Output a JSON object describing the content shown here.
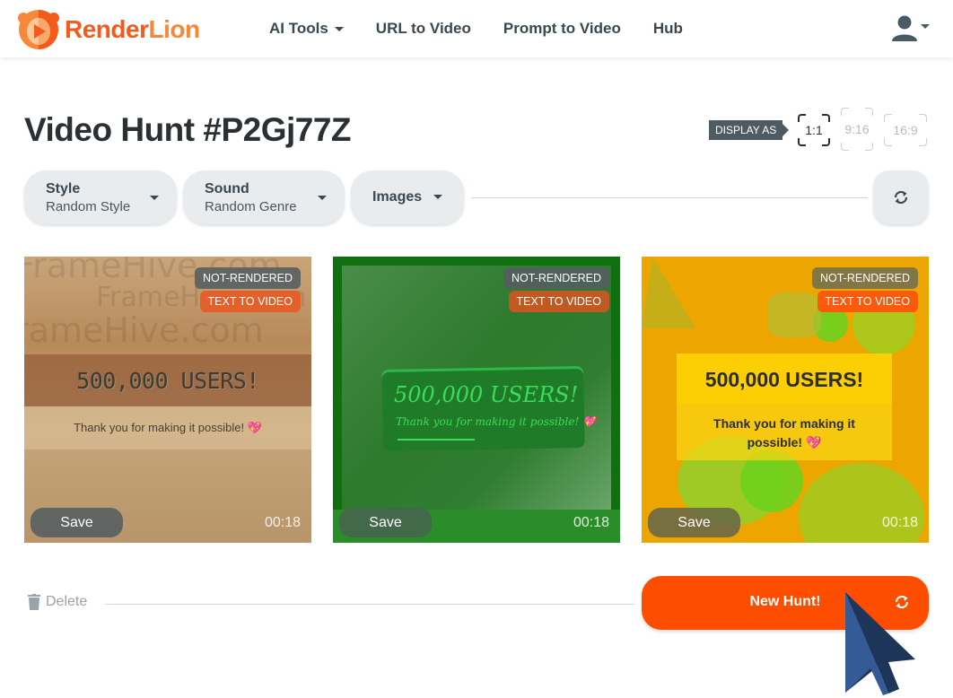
{
  "brand": {
    "name_part1": "Render",
    "name_part2": "Lion",
    "color_primary": "#f35b1d",
    "color_secondary": "#f7883a"
  },
  "nav": {
    "items": [
      {
        "label": "AI Tools",
        "has_dropdown": true
      },
      {
        "label": "URL to Video",
        "has_dropdown": false
      },
      {
        "label": "Prompt to Video",
        "has_dropdown": false
      },
      {
        "label": "Hub",
        "has_dropdown": false
      }
    ],
    "user_icon": "user-icon"
  },
  "page": {
    "title": "Video Hunt #P2Gj77Z"
  },
  "display_as": {
    "label": "DISPLAY AS",
    "options": [
      {
        "label": "1:1",
        "active": true
      },
      {
        "label": "9:16",
        "active": false
      },
      {
        "label": "16:9",
        "active": false
      }
    ]
  },
  "filters": {
    "style": {
      "label": "Style",
      "value": "Random Style"
    },
    "sound": {
      "label": "Sound",
      "value": "Random Genre"
    },
    "images": {
      "label": "Images"
    },
    "refresh_icon": "refresh-icon"
  },
  "cards": [
    {
      "status_badge": "NOT-RENDERED",
      "type_badge": "TEXT TO VIDEO",
      "headline": "500,000 USERS!",
      "subtext": "Thank you for making it possible! 💖",
      "watermark": "FrameHive.com",
      "save_label": "Save",
      "duration": "00:18"
    },
    {
      "status_badge": "NOT-RENDERED",
      "type_badge": "TEXT TO VIDEO",
      "headline": "500,000 USERS!",
      "subtext": "Thank you for making it possible! 💖",
      "save_label": "Save",
      "duration": "00:18"
    },
    {
      "status_badge": "NOT-RENDERED",
      "type_badge": "TEXT TO VIDEO",
      "headline": "500,000 USERS!",
      "subtext": "Thank you for making it possible! 💖",
      "save_label": "Save",
      "duration": "00:18"
    }
  ],
  "actions": {
    "delete_label": "Delete",
    "new_hunt_label": "New Hunt!",
    "accent_color": "#fd4d00"
  }
}
